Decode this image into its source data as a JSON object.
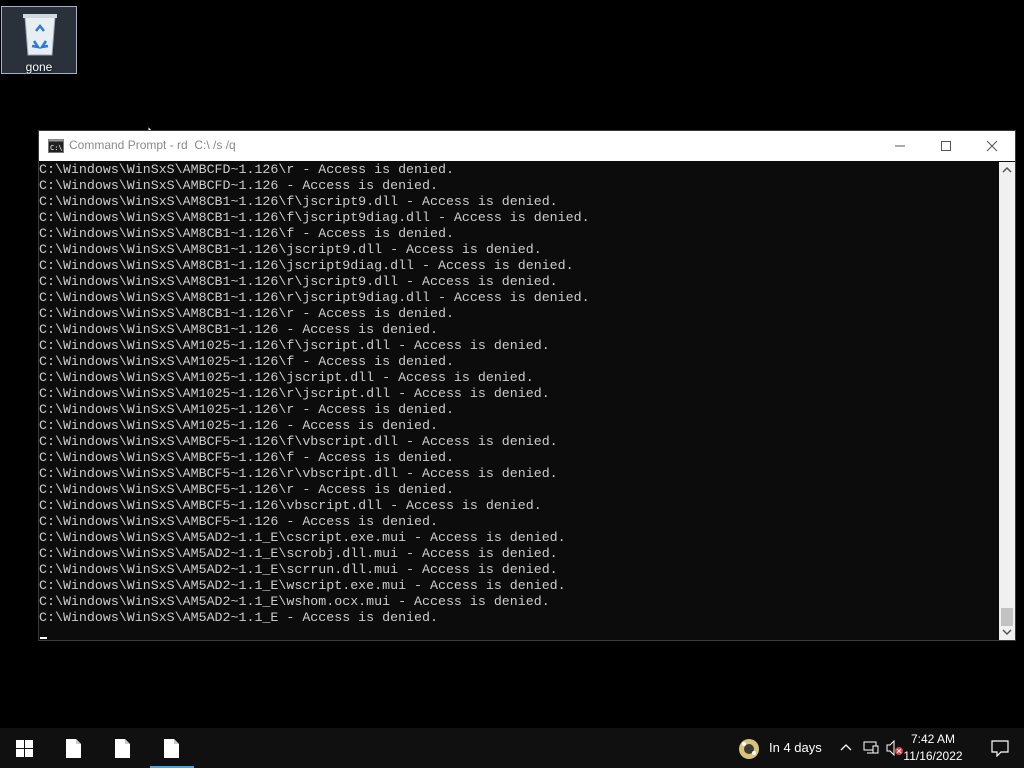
{
  "desktop": {
    "icons": [
      {
        "label": "gone",
        "icon": "recycle-bin-icon"
      }
    ]
  },
  "console": {
    "title": "Command Prompt - rd  C:\\ /s /q",
    "lines": [
      "C:\\Windows\\WinSxS\\AMBCFD~1.126\\r - Access is denied.",
      "C:\\Windows\\WinSxS\\AMBCFD~1.126 - Access is denied.",
      "C:\\Windows\\WinSxS\\AM8CB1~1.126\\f\\jscript9.dll - Access is denied.",
      "C:\\Windows\\WinSxS\\AM8CB1~1.126\\f\\jscript9diag.dll - Access is denied.",
      "C:\\Windows\\WinSxS\\AM8CB1~1.126\\f - Access is denied.",
      "C:\\Windows\\WinSxS\\AM8CB1~1.126\\jscript9.dll - Access is denied.",
      "C:\\Windows\\WinSxS\\AM8CB1~1.126\\jscript9diag.dll - Access is denied.",
      "C:\\Windows\\WinSxS\\AM8CB1~1.126\\r\\jscript9.dll - Access is denied.",
      "C:\\Windows\\WinSxS\\AM8CB1~1.126\\r\\jscript9diag.dll - Access is denied.",
      "C:\\Windows\\WinSxS\\AM8CB1~1.126\\r - Access is denied.",
      "C:\\Windows\\WinSxS\\AM8CB1~1.126 - Access is denied.",
      "C:\\Windows\\WinSxS\\AM1025~1.126\\f\\jscript.dll - Access is denied.",
      "C:\\Windows\\WinSxS\\AM1025~1.126\\f - Access is denied.",
      "C:\\Windows\\WinSxS\\AM1025~1.126\\jscript.dll - Access is denied.",
      "C:\\Windows\\WinSxS\\AM1025~1.126\\r\\jscript.dll - Access is denied.",
      "C:\\Windows\\WinSxS\\AM1025~1.126\\r - Access is denied.",
      "C:\\Windows\\WinSxS\\AM1025~1.126 - Access is denied.",
      "C:\\Windows\\WinSxS\\AMBCF5~1.126\\f\\vbscript.dll - Access is denied.",
      "C:\\Windows\\WinSxS\\AMBCF5~1.126\\f - Access is denied.",
      "C:\\Windows\\WinSxS\\AMBCF5~1.126\\r\\vbscript.dll - Access is denied.",
      "C:\\Windows\\WinSxS\\AMBCF5~1.126\\r - Access is denied.",
      "C:\\Windows\\WinSxS\\AMBCF5~1.126\\vbscript.dll - Access is denied.",
      "C:\\Windows\\WinSxS\\AMBCF5~1.126 - Access is denied.",
      "C:\\Windows\\WinSxS\\AM5AD2~1.1_E\\cscript.exe.mui - Access is denied.",
      "C:\\Windows\\WinSxS\\AM5AD2~1.1_E\\scrobj.dll.mui - Access is denied.",
      "C:\\Windows\\WinSxS\\AM5AD2~1.1_E\\scrrun.dll.mui - Access is denied.",
      "C:\\Windows\\WinSxS\\AM5AD2~1.1_E\\wscript.exe.mui - Access is denied.",
      "C:\\Windows\\WinSxS\\AM5AD2~1.1_E\\wshom.ocx.mui - Access is denied.",
      "C:\\Windows\\WinSxS\\AM5AD2~1.1_E - Access is denied."
    ]
  },
  "taskbar": {
    "buttons": [
      {
        "name": "start-button",
        "icon": "windows-logo-icon"
      },
      {
        "name": "taskbar-file-1",
        "icon": "document-icon"
      },
      {
        "name": "taskbar-file-2",
        "icon": "document-icon"
      },
      {
        "name": "taskbar-file-3",
        "icon": "document-icon",
        "active": true
      }
    ],
    "weather_text": "In 4 days",
    "clock": {
      "time": "7:42 AM",
      "date": "11/16/2022"
    }
  },
  "colors": {
    "console_bg": "#0c0c0c",
    "console_text": "#cccccc",
    "accent": "#4ea1e6"
  }
}
